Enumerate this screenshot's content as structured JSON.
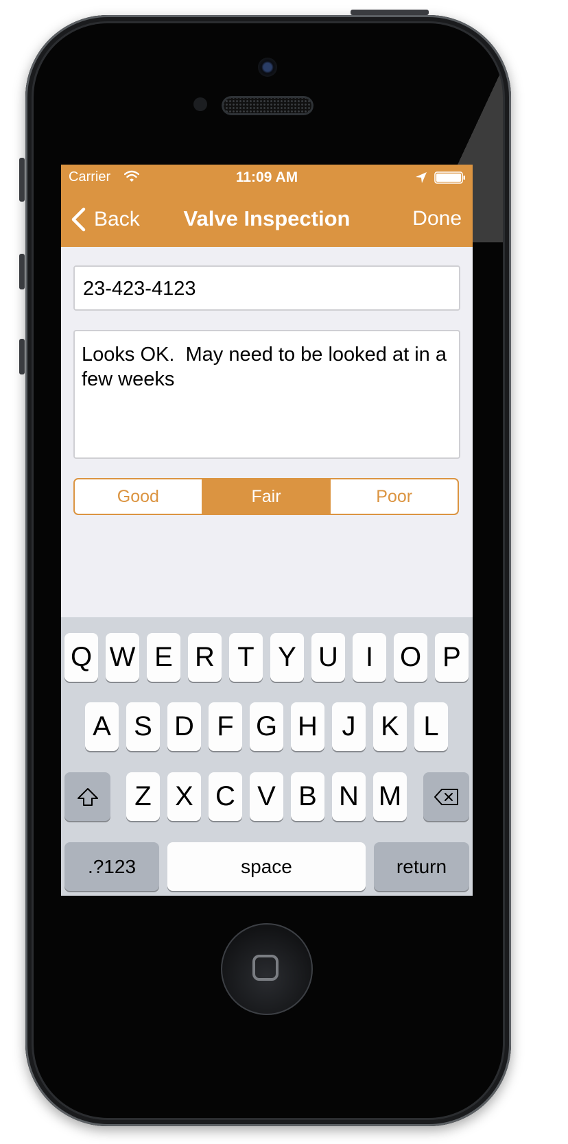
{
  "status_bar": {
    "carrier": "Carrier",
    "time": "11:09 AM",
    "wifi_icon": "wifi-icon",
    "location_icon": "location-arrow-icon",
    "battery_icon": "battery-icon"
  },
  "nav": {
    "back_label": "Back",
    "title": "Valve Inspection",
    "done_label": "Done",
    "accent_color": "#db9441"
  },
  "form": {
    "id_value": "23-423-4123",
    "notes_value": "Looks OK.  May need to be looked at in a few weeks"
  },
  "condition": {
    "options": [
      "Good",
      "Fair",
      "Poor"
    ],
    "selected": "Fair"
  },
  "keyboard": {
    "row1": [
      "Q",
      "W",
      "E",
      "R",
      "T",
      "Y",
      "U",
      "I",
      "O",
      "P"
    ],
    "row2": [
      "A",
      "S",
      "D",
      "F",
      "G",
      "H",
      "J",
      "K",
      "L"
    ],
    "row3": [
      "Z",
      "X",
      "C",
      "V",
      "B",
      "N",
      "M"
    ],
    "shift_icon": "shift-arrow-icon",
    "delete_icon": "backspace-icon",
    "numbers_label": ".?123",
    "space_label": "space",
    "return_label": "return"
  }
}
